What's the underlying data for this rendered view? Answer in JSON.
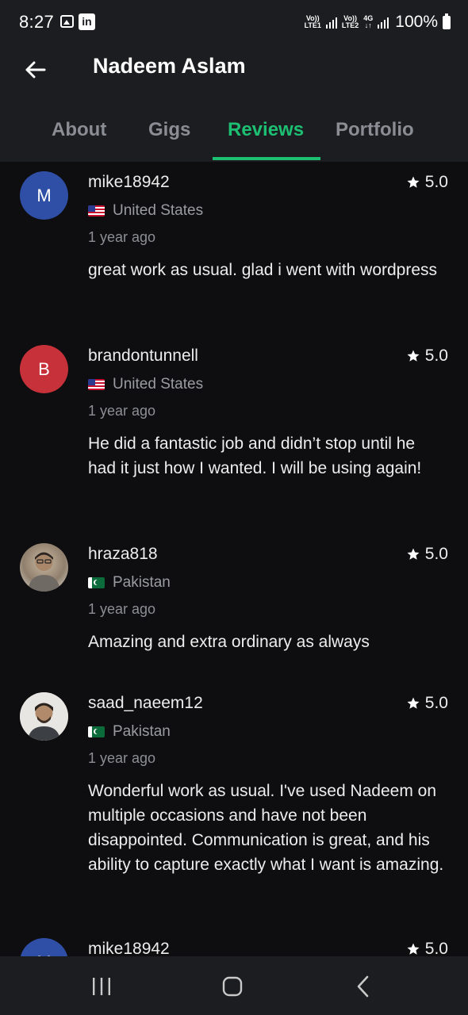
{
  "status_bar": {
    "time": "8:27",
    "battery": "100%",
    "sim1_label": "Vo)) LTE1",
    "sim2_label": "Vo)) LTE2",
    "network_label": "4G"
  },
  "header": {
    "title": "Nadeem Aslam"
  },
  "tabs": {
    "about": "About",
    "gigs": "Gigs",
    "reviews": "Reviews",
    "portfolio": "Portfolio",
    "active": "Reviews"
  },
  "reviews": [
    {
      "avatar_letter": "M",
      "avatar_color": "#2f4fa6",
      "name": "mike18942",
      "rating": "5.0",
      "country": "United States",
      "date": "1 year ago",
      "text": "great work as usual. glad i went with wordpress"
    },
    {
      "avatar_letter": "B",
      "avatar_color": "#c7313a",
      "name": "brandontunnell",
      "rating": "5.0",
      "country": "United States",
      "date": "1 year ago",
      "text": "He did a fantastic job and didn’t stop until he had it just how I wanted. I will be using again!"
    },
    {
      "avatar_letter": "",
      "name": "hraza818",
      "rating": "5.0",
      "country": "Pakistan",
      "date": "1 year ago",
      "text": "Amazing and extra ordinary as always"
    },
    {
      "avatar_letter": "",
      "name": "saad_naeem12",
      "rating": "5.0",
      "country": "Pakistan",
      "date": "1 year ago",
      "text": "Wonderful work as usual. I've used Nadeem on multiple occasions and have not been disappointed. Communication is great, and his ability to capture exactly what I want is amazing."
    },
    {
      "avatar_letter": "M",
      "avatar_color": "#2f4fa6",
      "name": "mike18942",
      "rating": "5.0"
    }
  ],
  "colors": {
    "accent": "#1dbf73",
    "background": "#0e0e10",
    "header_bg": "#1c1d20"
  }
}
